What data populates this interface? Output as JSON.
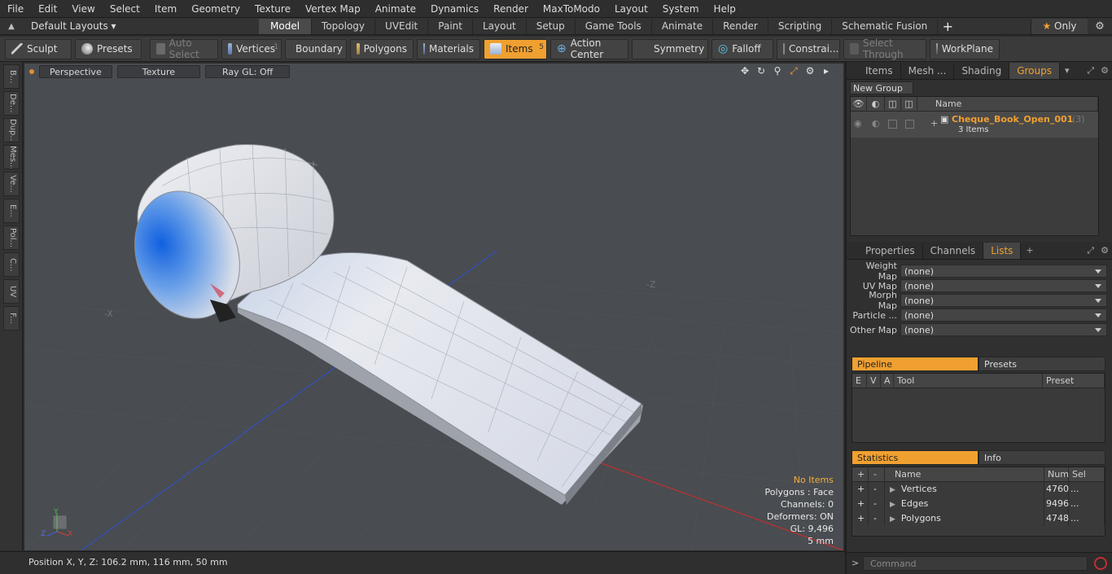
{
  "menu": [
    "File",
    "Edit",
    "View",
    "Select",
    "Item",
    "Geometry",
    "Texture",
    "Vertex Map",
    "Animate",
    "Dynamics",
    "Render",
    "MaxToModo",
    "Layout",
    "System",
    "Help"
  ],
  "layout": {
    "default_layouts": "Default Layouts",
    "tabs": [
      "Model",
      "Topology",
      "UVEdit",
      "Paint",
      "Layout",
      "Setup",
      "Game Tools",
      "Animate",
      "Render",
      "Scripting",
      "Schematic Fusion"
    ],
    "active_tab": "Model",
    "only_label": "Only"
  },
  "toolbar": {
    "sculpt": "Sculpt",
    "presets": "Presets",
    "auto_select": "Auto Select",
    "vertices": "Vertices",
    "vertices_count": "1",
    "boundary": "Boundary",
    "polygons": "Polygons",
    "materials": "Materials",
    "items": "Items",
    "items_count": "5",
    "action_center": "Action Center",
    "symmetry": "Symmetry",
    "falloff": "Falloff",
    "constraints": "Constrai...",
    "select_through": "Select Through",
    "workplane": "WorkPlane"
  },
  "left_tabs": [
    "B...",
    "De...",
    "Dup...",
    "Mes...",
    "Ve...",
    "E...",
    "Pol...",
    "C...",
    "UV",
    "F..."
  ],
  "viewport": {
    "perspective": "Perspective",
    "texture": "Texture",
    "raygl": "Ray GL: Off",
    "axis_x": "-X",
    "axis_z": "-Z",
    "hud": {
      "no_items": "No Items",
      "polygons": "Polygons : Face",
      "channels": "Channels: 0",
      "deformers": "Deformers: ON",
      "gl": "GL: 9,496",
      "unit": "5 mm"
    },
    "gizmo": {
      "x": "X",
      "y": "Y",
      "z": "Z"
    }
  },
  "status": {
    "position": "Position X, Y, Z:   106.2 mm, 116 mm, 50 mm"
  },
  "groups_panel": {
    "tabs": [
      "Items",
      "Mesh ...",
      "Shading",
      "Groups"
    ],
    "active_tab": "Groups",
    "new_group": "New Group",
    "name_header": "Name",
    "group_name": "Cheque_Book_Open_001",
    "group_count": "(3)",
    "group_sub": "3 Items"
  },
  "props_panel": {
    "tabs": [
      "Properties",
      "Channels",
      "Lists"
    ],
    "active_tab": "Lists",
    "maps": [
      {
        "label": "Weight Map",
        "value": "(none)"
      },
      {
        "label": "UV Map",
        "value": "(none)"
      },
      {
        "label": "Morph Map",
        "value": "(none)"
      },
      {
        "label": "Particle ...",
        "value": "(none)"
      },
      {
        "label": "Other Map",
        "value": "(none)"
      }
    ]
  },
  "pipeline": {
    "tabs": [
      "Pipeline",
      "Presets"
    ],
    "headers": [
      "E",
      "V",
      "A",
      "Tool",
      "Preset"
    ]
  },
  "statistics": {
    "tabs": [
      "Statistics",
      "Info"
    ],
    "headers": {
      "plus": "+",
      "minus": "-",
      "name": "Name",
      "num": "Num",
      "sel": "Sel"
    },
    "rows": [
      {
        "name": "Vertices",
        "num": "4760",
        "sel": "..."
      },
      {
        "name": "Edges",
        "num": "9496",
        "sel": "..."
      },
      {
        "name": "Polygons",
        "num": "4748",
        "sel": "..."
      }
    ]
  },
  "command": {
    "placeholder": "Command"
  },
  "colors": {
    "accent": "#f0a030",
    "viewport_bg": "#494c50"
  }
}
